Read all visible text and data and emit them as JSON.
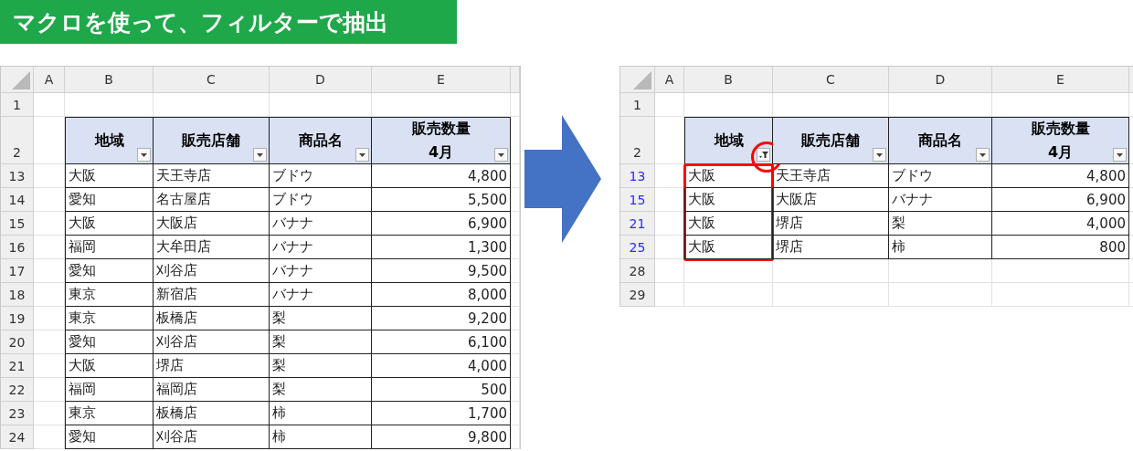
{
  "title": "マクロを使って、フィルターで抽出",
  "sheets": [
    {
      "columns": [
        "A",
        "B",
        "C",
        "D",
        "E"
      ],
      "top_rows": [
        "1"
      ],
      "header_row": {
        "row": "2",
        "cells": [
          {
            "lines": [
              "地域"
            ],
            "kind": "text",
            "filter_applied": false,
            "highlighted": false
          },
          {
            "lines": [
              "販売店舗"
            ],
            "kind": "text",
            "filter_applied": false,
            "highlighted": false
          },
          {
            "lines": [
              "商品名"
            ],
            "kind": "text",
            "filter_applied": false,
            "highlighted": false
          },
          {
            "lines": [
              "販売数量",
              "4月"
            ],
            "kind": "number",
            "filter_applied": false,
            "highlighted": false
          }
        ]
      },
      "data_rows": [
        {
          "row": "13",
          "filtered": false,
          "cells": [
            "大阪",
            "天王寺店",
            "ブドウ",
            "4,800"
          ]
        },
        {
          "row": "14",
          "filtered": false,
          "cells": [
            "愛知",
            "名古屋店",
            "ブドウ",
            "5,500"
          ]
        },
        {
          "row": "15",
          "filtered": false,
          "cells": [
            "大阪",
            "大阪店",
            "バナナ",
            "6,900"
          ]
        },
        {
          "row": "16",
          "filtered": false,
          "cells": [
            "福岡",
            "大牟田店",
            "バナナ",
            "1,300"
          ]
        },
        {
          "row": "17",
          "filtered": false,
          "cells": [
            "愛知",
            "刈谷店",
            "バナナ",
            "9,500"
          ]
        },
        {
          "row": "18",
          "filtered": false,
          "cells": [
            "東京",
            "新宿店",
            "バナナ",
            "8,000"
          ]
        },
        {
          "row": "19",
          "filtered": false,
          "cells": [
            "東京",
            "板橋店",
            "梨",
            "9,200"
          ]
        },
        {
          "row": "20",
          "filtered": false,
          "cells": [
            "愛知",
            "刈谷店",
            "梨",
            "6,100"
          ]
        },
        {
          "row": "21",
          "filtered": false,
          "cells": [
            "大阪",
            "堺店",
            "梨",
            "4,000"
          ]
        },
        {
          "row": "22",
          "filtered": false,
          "cells": [
            "福岡",
            "福岡店",
            "梨",
            "500"
          ]
        },
        {
          "row": "23",
          "filtered": false,
          "cells": [
            "東京",
            "板橋店",
            "柿",
            "1,700"
          ]
        },
        {
          "row": "24",
          "filtered": false,
          "cells": [
            "愛知",
            "刈谷店",
            "柿",
            "9,800"
          ]
        }
      ]
    },
    {
      "columns": [
        "A",
        "B",
        "C",
        "D",
        "E"
      ],
      "top_rows": [
        "1"
      ],
      "header_row": {
        "row": "2",
        "cells": [
          {
            "lines": [
              "地域"
            ],
            "kind": "text",
            "filter_applied": true,
            "highlighted": true
          },
          {
            "lines": [
              "販売店舗"
            ],
            "kind": "text",
            "filter_applied": false,
            "highlighted": false
          },
          {
            "lines": [
              "商品名"
            ],
            "kind": "text",
            "filter_applied": false,
            "highlighted": false
          },
          {
            "lines": [
              "販売数量",
              "4月"
            ],
            "kind": "number",
            "filter_applied": false,
            "highlighted": false
          }
        ]
      },
      "data_rows": [
        {
          "row": "13",
          "filtered": true,
          "cells": [
            "大阪",
            "天王寺店",
            "ブドウ",
            "4,800"
          ]
        },
        {
          "row": "15",
          "filtered": true,
          "cells": [
            "大阪",
            "大阪店",
            "バナナ",
            "6,900"
          ]
        },
        {
          "row": "21",
          "filtered": true,
          "cells": [
            "大阪",
            "堺店",
            "梨",
            "4,000"
          ]
        },
        {
          "row": "25",
          "filtered": true,
          "cells": [
            "大阪",
            "堺店",
            "柿",
            "800"
          ]
        }
      ],
      "bottom_rows": [
        "28",
        "29"
      ]
    }
  ]
}
